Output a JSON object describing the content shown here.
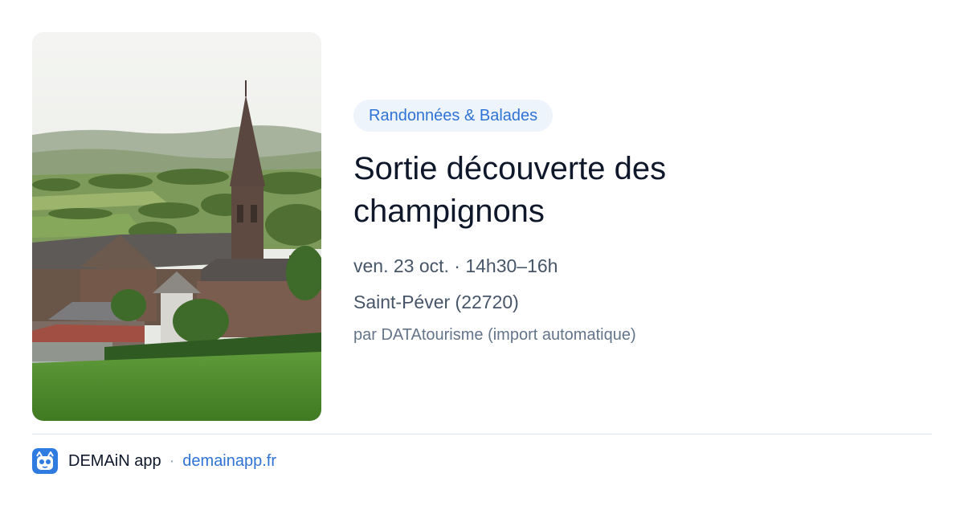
{
  "event": {
    "category": "Randonnées & Balades",
    "title": "Sortie découverte des champignons",
    "datetime": "ven. 23 oct. · 14h30–16h",
    "location": "Saint-Péver (22720)",
    "author": "par DATAtourisme (import automatique)"
  },
  "footer": {
    "app_name": "DEMAiN app",
    "separator": "·",
    "link_text": "demainapp.fr"
  },
  "colors": {
    "accent": "#2f73d4",
    "category_bg": "#eef4fc",
    "title": "#0f172a",
    "meta": "#475569",
    "author": "#64748b"
  },
  "icons": {
    "app_logo": "demain-app-logo-icon"
  }
}
